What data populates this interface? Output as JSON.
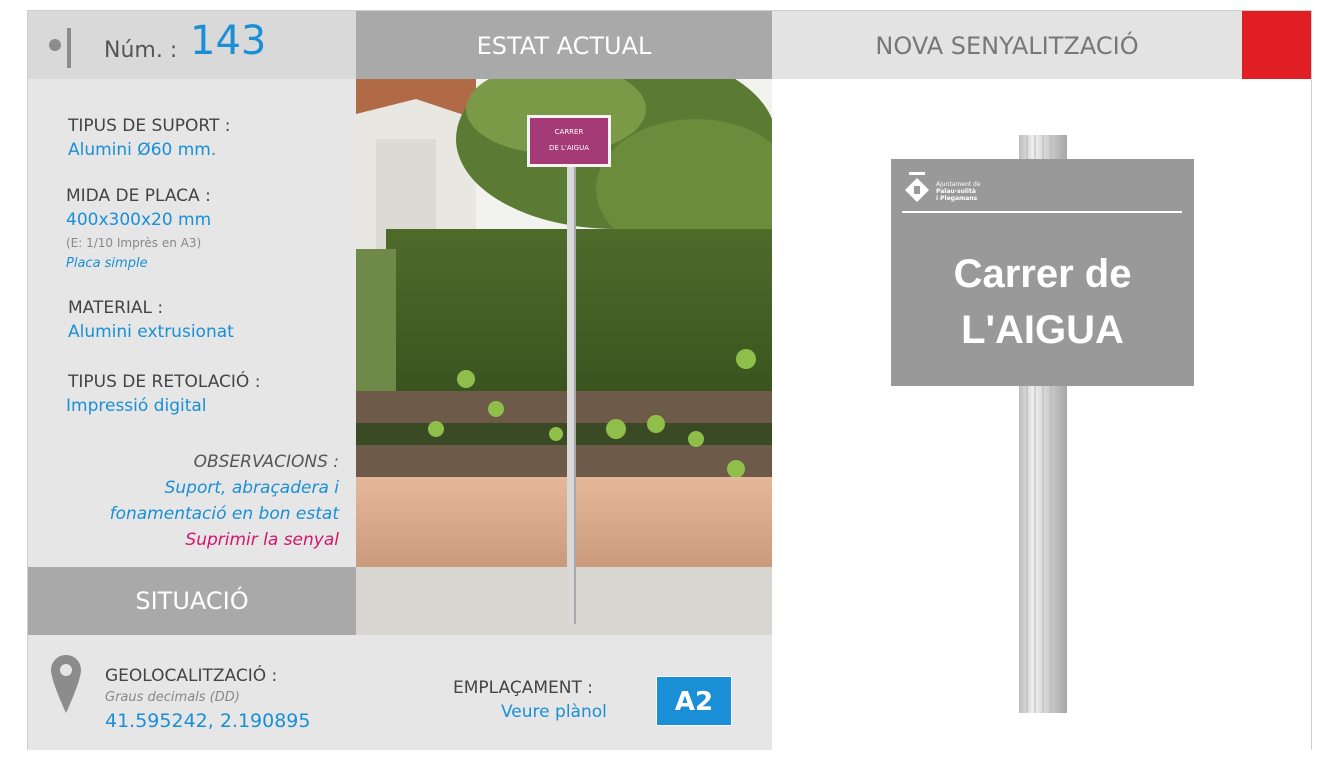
{
  "header": {
    "num_label": "Núm. :",
    "num_value": "143",
    "estat_actual": "ESTAT ACTUAL",
    "nova_senyalitzacio": "NOVA SENYALITZACIÓ",
    "accent_color": "#e01e24"
  },
  "info": {
    "suport_label": "TIPUS DE SUPORT :",
    "suport_value": "Alumini Ø60 mm.",
    "mida_label": "MIDA DE PLACA :",
    "mida_value": "400x300x20 mm",
    "mida_escala": "(E: 1/10 Imprès en A3)",
    "mida_tipus": "Placa simple",
    "material_label": "MATERIAL :",
    "material_value": "Alumini extrusionat",
    "retolacio_label": "TIPUS DE RETOLACIÓ :",
    "retolacio_value": "Impressió digital",
    "observacions_label": "OBSERVACIONS :",
    "observacions_line1": "Suport, abraçadera i",
    "observacions_line2": "fonamentació en bon estat",
    "observacions_line3": "Suprimir la senyal"
  },
  "situacio": {
    "title": "SITUACIÓ",
    "geo_label": "GEOLOCALITZACIÓ :",
    "geo_format": "Graus decimals (DD)",
    "geo_value": "41.595242, 2.190895",
    "empl_label": "EMPLAÇAMENT :",
    "empl_link": "Veure plànol",
    "empl_code": "A2"
  },
  "photo": {
    "sign_line1": "CARRER",
    "sign_line2": "DE L'AIGUA"
  },
  "new_sign": {
    "logo_line1": "Ajuntament de",
    "logo_line2": "Palau-solità",
    "logo_line3": "i Plegamans",
    "text_line1": "Carrer de",
    "text_line2": "L'AIGUA"
  },
  "colors": {
    "blue": "#1a8fd6",
    "magenta": "#d6156f",
    "plate_grey": "#999999"
  }
}
